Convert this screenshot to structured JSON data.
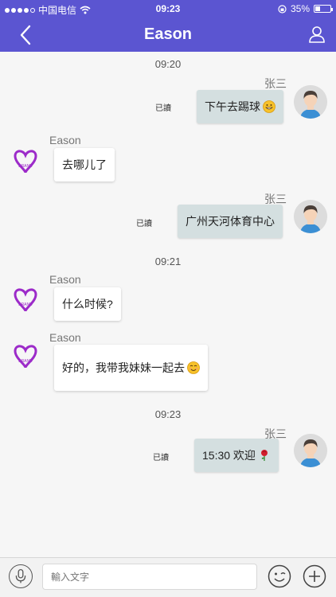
{
  "status_bar": {
    "carrier": "中国电信",
    "time": "09:23",
    "battery": "35%",
    "battery_level": 0.35
  },
  "nav": {
    "title": "Eason"
  },
  "messages": [
    {
      "time": "09:20"
    },
    {
      "sender": "张三",
      "text": "下午去踢球",
      "read": "已讀"
    },
    {
      "sender": "Eason",
      "text": "去哪儿了"
    },
    {
      "sender": "张三",
      "text": "广州天河体育中心",
      "read": "已讀"
    },
    {
      "time": "09:21"
    },
    {
      "sender": "Eason",
      "text": "什么时候?"
    },
    {
      "sender": "Eason",
      "text": "好的，我带我妹妹一起去"
    },
    {
      "time": "09:23"
    },
    {
      "sender": "张三",
      "text": "15:30 欢迎",
      "read": "已讀"
    }
  ],
  "input": {
    "placeholder": "輸入文字"
  },
  "colors": {
    "nav": "#5b55d1",
    "bubble_self": "#d4dfe0",
    "bubble_other": "#ffffff",
    "logo": "#9c2bc9"
  }
}
